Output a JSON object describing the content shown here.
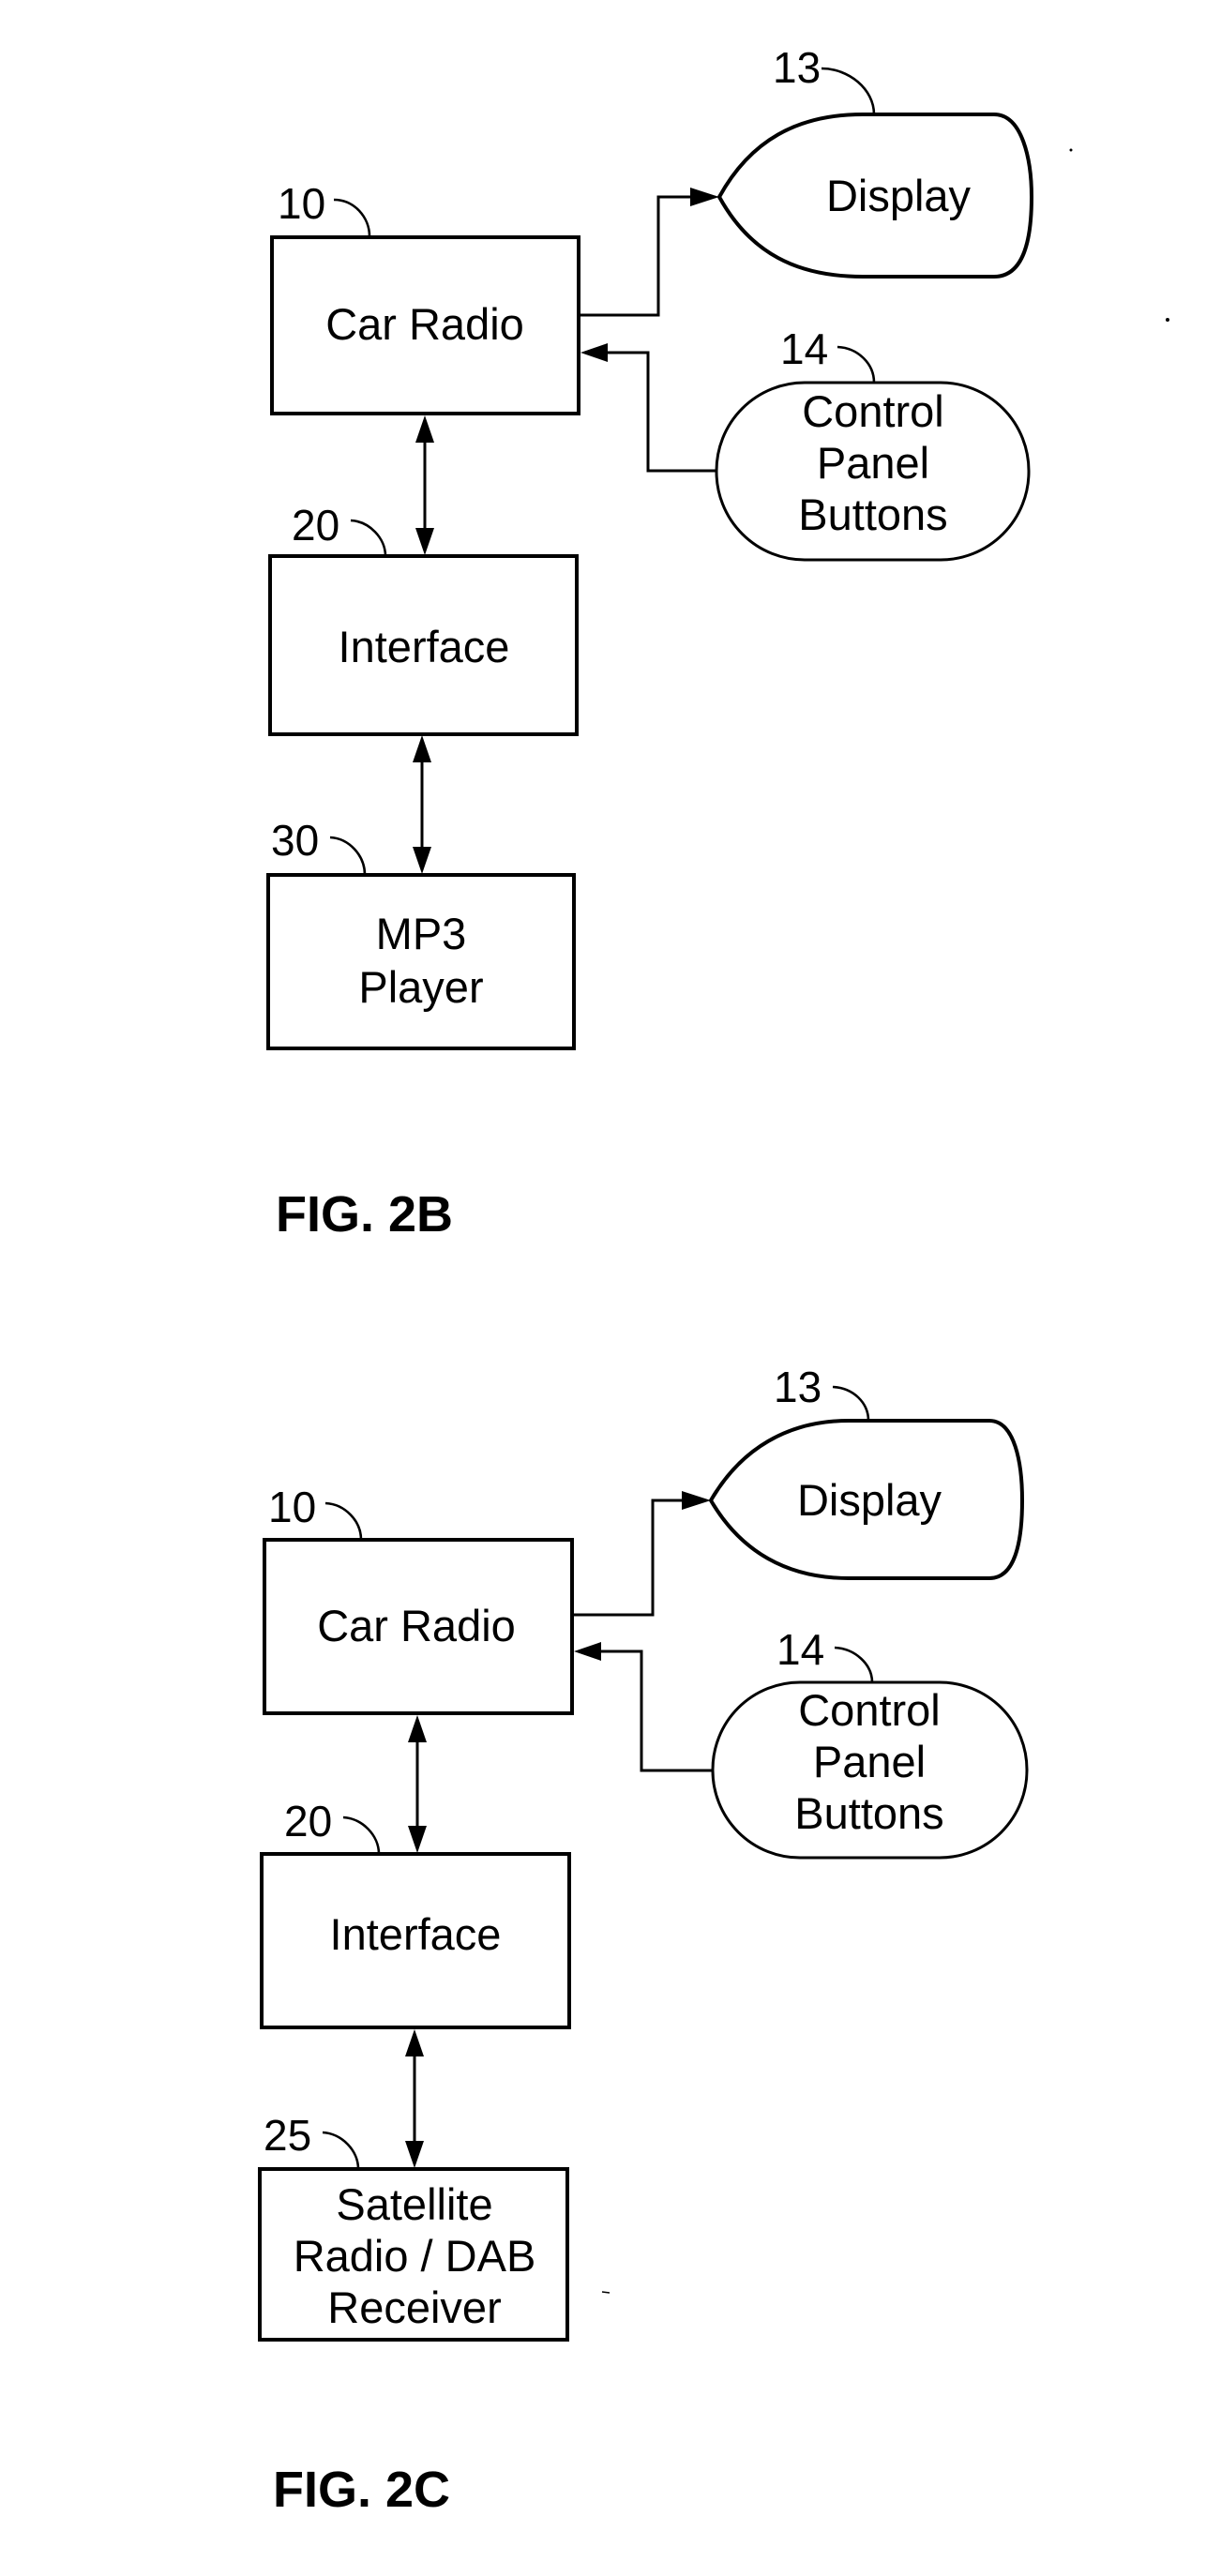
{
  "figures": [
    {
      "caption": "FIG. 2B",
      "blocks": {
        "car_radio": {
          "ref": "10",
          "label": "Car Radio"
        },
        "interface": {
          "ref": "20",
          "label": "Interface"
        },
        "source": {
          "ref": "30",
          "lines": [
            "MP3",
            "Player"
          ]
        },
        "display": {
          "ref": "13",
          "label": "Display"
        },
        "control_panel": {
          "ref": "14",
          "lines": [
            "Control",
            "Panel",
            "Buttons"
          ]
        }
      }
    },
    {
      "caption": "FIG. 2C",
      "blocks": {
        "car_radio": {
          "ref": "10",
          "label": "Car Radio"
        },
        "interface": {
          "ref": "20",
          "label": "Interface"
        },
        "source": {
          "ref": "25",
          "lines": [
            "Satellite",
            "Radio / DAB",
            "Receiver"
          ]
        },
        "display": {
          "ref": "13",
          "label": "Display"
        },
        "control_panel": {
          "ref": "14",
          "lines": [
            "Control",
            "Panel",
            "Buttons"
          ]
        }
      }
    }
  ]
}
